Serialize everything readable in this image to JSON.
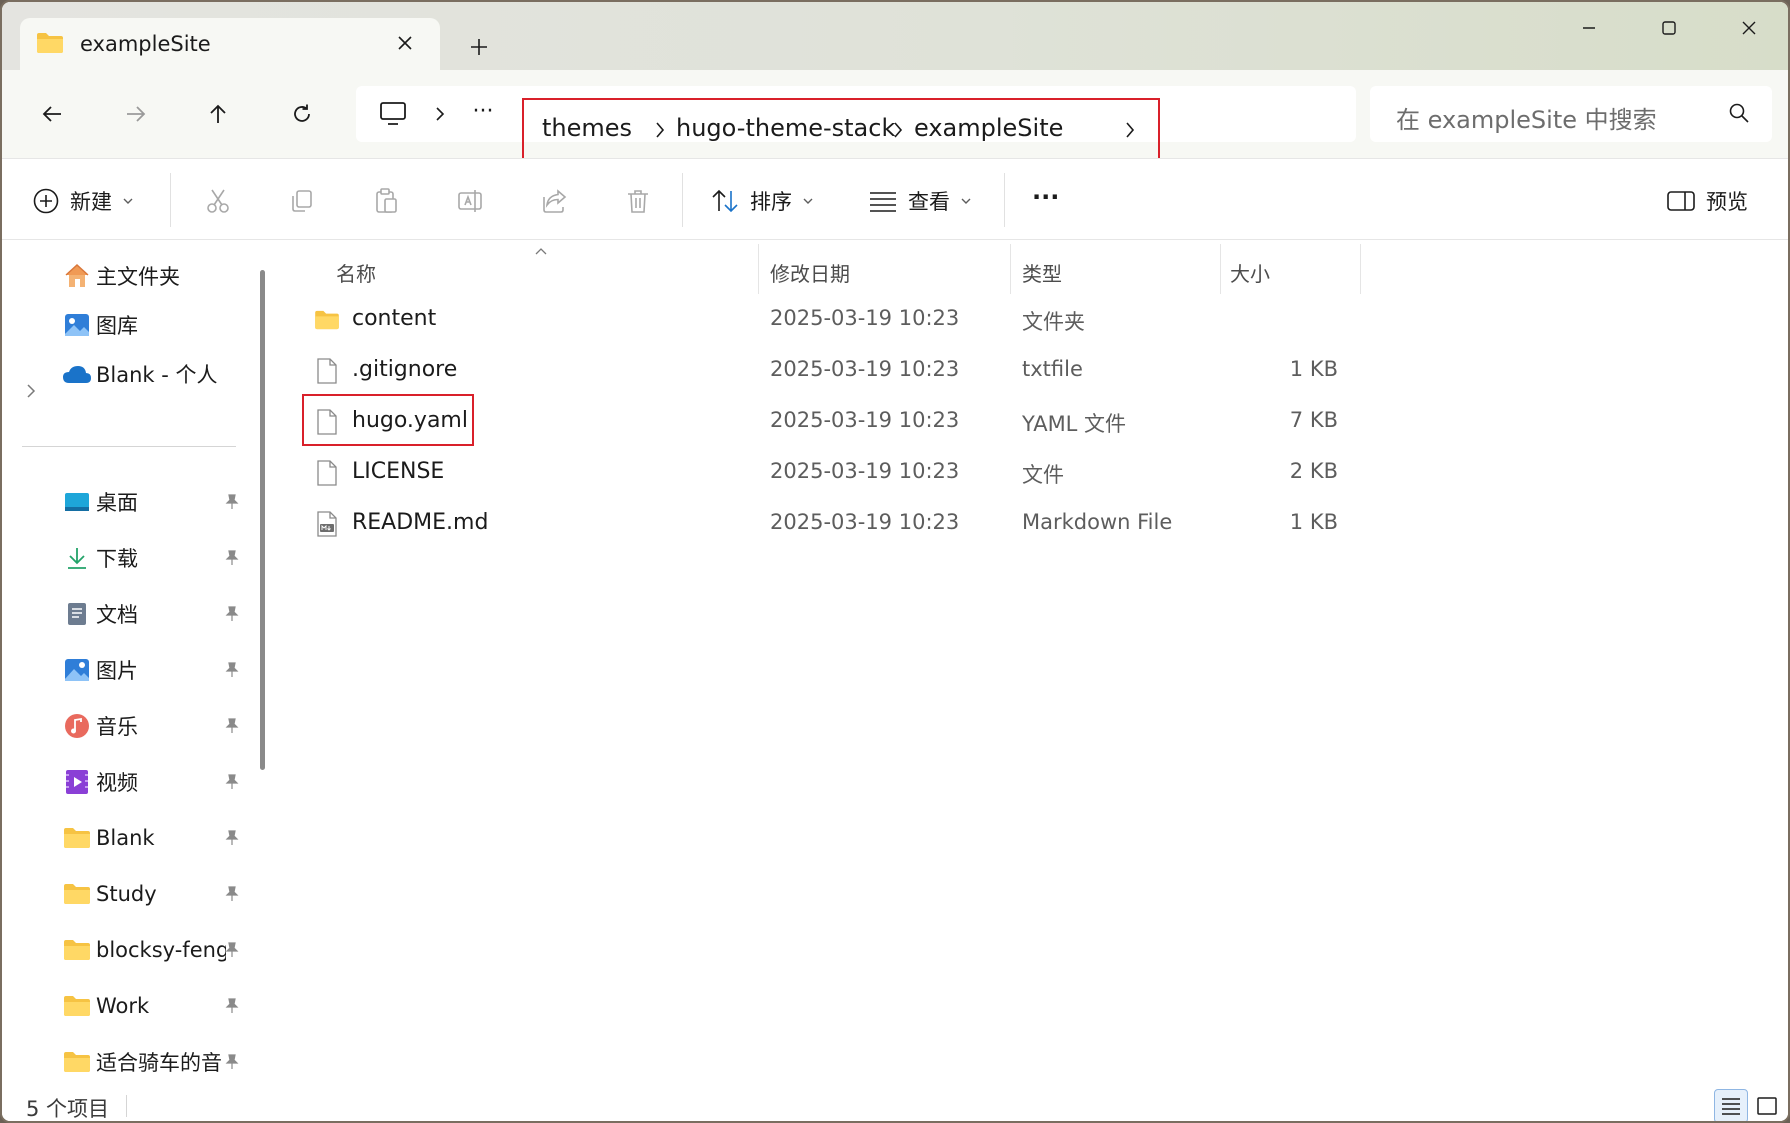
{
  "window": {
    "tab_title": "exampleSite",
    "new_tab_label": "+"
  },
  "address": {
    "breadcrumbs": [
      "themes",
      "hugo-theme-stack",
      "exampleSite"
    ],
    "overflow_label": "···"
  },
  "search": {
    "placeholder": "在 exampleSite 中搜索"
  },
  "toolbar": {
    "new_label": "新建",
    "sort_label": "排序",
    "view_label": "查看",
    "more_label": "···",
    "preview_label": "预览"
  },
  "sidebar": {
    "top_items": [
      {
        "label": "主文件夹",
        "icon": "home-icon"
      },
      {
        "label": "图库",
        "icon": "gallery-icon"
      },
      {
        "label": "Blank - 个人",
        "icon": "onedrive-cloud-icon"
      }
    ],
    "pinned_items": [
      {
        "label": "桌面",
        "icon": "desktop-icon"
      },
      {
        "label": "下载",
        "icon": "download-icon"
      },
      {
        "label": "文档",
        "icon": "documents-icon"
      },
      {
        "label": "图片",
        "icon": "pictures-icon"
      },
      {
        "label": "音乐",
        "icon": "music-icon"
      },
      {
        "label": "视频",
        "icon": "video-icon"
      },
      {
        "label": "Blank",
        "icon": "folder-icon"
      },
      {
        "label": "Study",
        "icon": "folder-icon"
      },
      {
        "label": "blocksy-feng",
        "icon": "folder-icon"
      },
      {
        "label": "Work",
        "icon": "folder-icon"
      },
      {
        "label": "适合骑车的音",
        "icon": "folder-icon"
      }
    ]
  },
  "file_list": {
    "columns": [
      "名称",
      "修改日期",
      "类型",
      "大小"
    ],
    "rows": [
      {
        "name": "content",
        "date": "2025-03-19 10:23",
        "type": "文件夹",
        "size": "",
        "icon": "folder-icon"
      },
      {
        "name": ".gitignore",
        "date": "2025-03-19 10:23",
        "type": "txtfile",
        "size": "1 KB",
        "icon": "file-icon"
      },
      {
        "name": "hugo.yaml",
        "date": "2025-03-19 10:23",
        "type": "YAML 文件",
        "size": "7 KB",
        "icon": "file-icon"
      },
      {
        "name": "LICENSE",
        "date": "2025-03-19 10:23",
        "type": "文件",
        "size": "2 KB",
        "icon": "file-icon"
      },
      {
        "name": "README.md",
        "date": "2025-03-19 10:23",
        "type": "Markdown File",
        "size": "1 KB",
        "icon": "markdown-file-icon"
      }
    ]
  },
  "status": {
    "item_count": "5 个项目"
  },
  "colors": {
    "highlight_border": "#d9202a",
    "folder_yellow": "#f6c343",
    "accent_blue": "#1a73c9"
  }
}
